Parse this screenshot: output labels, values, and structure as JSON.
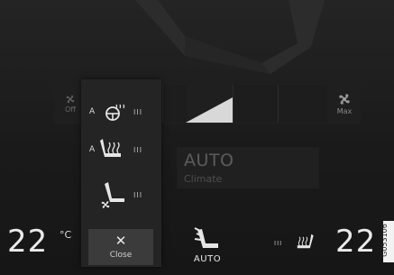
{
  "fan": {
    "off_label": "Off",
    "max_label": "Max",
    "level_fraction": 0.45
  },
  "auto_climate": {
    "title": "AUTO",
    "subtitle": "Climate"
  },
  "seat_panel": {
    "rows": [
      {
        "prefix": "A",
        "icon": "heated-steering-wheel-icon",
        "levels": "III"
      },
      {
        "prefix": "A",
        "icon": "heated-seat-icon",
        "levels": "III"
      },
      {
        "prefix": "",
        "icon": "ventilated-seat-icon",
        "levels": "III"
      }
    ],
    "close_label": "Close"
  },
  "bottom": {
    "temp_left": "22",
    "temp_unit": "°C",
    "auto_label": "AUTO",
    "seat_heat_levels": "III",
    "temp_right": "22"
  },
  "figure_code": "G053106"
}
